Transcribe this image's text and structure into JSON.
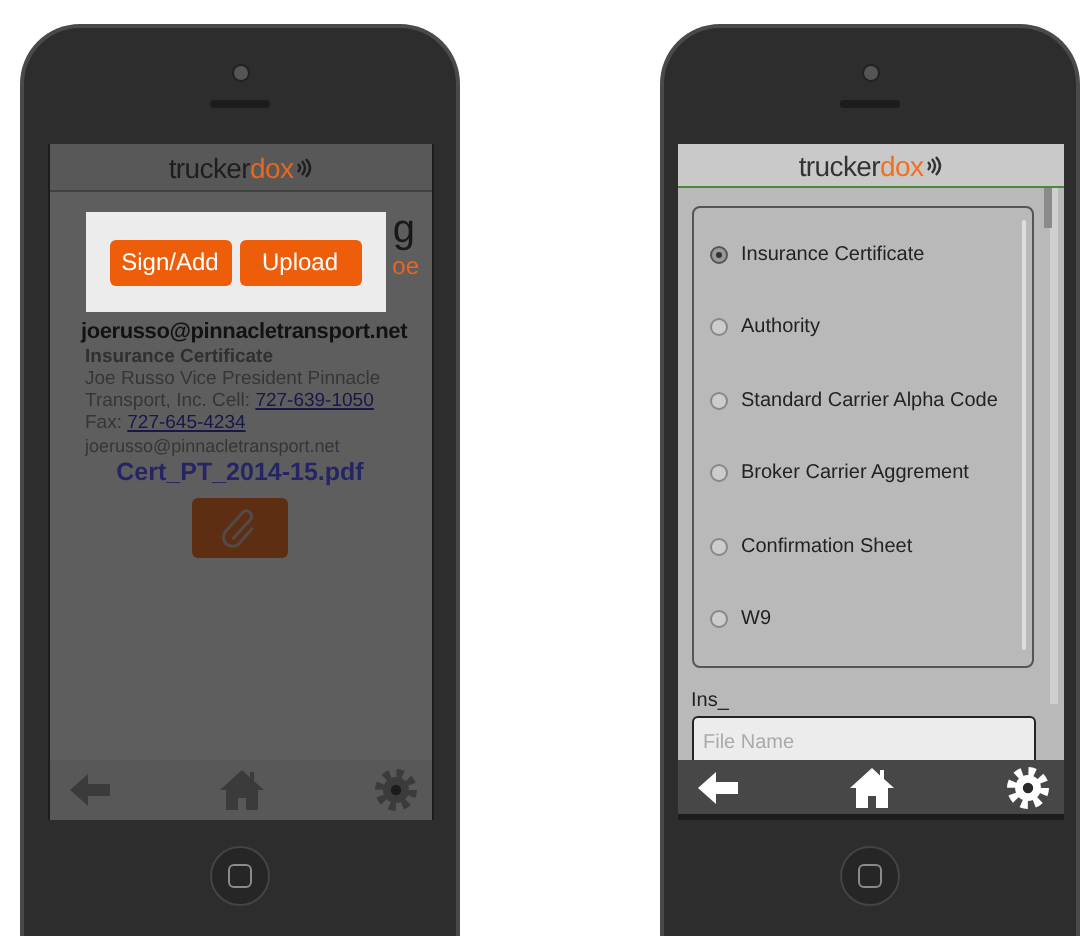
{
  "left_phone": {
    "logo": {
      "text": "trucker",
      "accent": "dox"
    },
    "dimmed": true,
    "heading_fragment": "g",
    "subheading_fragment": "oe",
    "popup": {
      "buttons": [
        "Sign/Add",
        "Upload"
      ]
    },
    "contact": {
      "email": "joerusso@pinnacletransport.net",
      "document_type": "Insurance Certificate",
      "details": [
        {
          "kind": "text",
          "text": "Joe Russo Vice President Pinnacle Transport, Inc. Cell: "
        },
        {
          "kind": "link",
          "text": "727-639-1050"
        },
        {
          "kind": "text",
          "text": " Fax: "
        },
        {
          "kind": "link",
          "text": "727-645-4234"
        }
      ],
      "email_small": "joerusso@pinnacletransport.net"
    },
    "file_link": "Cert_PT_2014-15.pdf"
  },
  "right_phone": {
    "logo": {
      "text": "trucker",
      "accent": "dox"
    },
    "documents": [
      {
        "label": "Insurance Certificate",
        "selected": true
      },
      {
        "label": "Authority",
        "selected": false
      },
      {
        "label": "Standard Carrier Alpha Code",
        "selected": false
      },
      {
        "label": "Broker Carrier Aggrement",
        "selected": false
      },
      {
        "label": "Confirmation Sheet",
        "selected": false
      },
      {
        "label": "W9",
        "selected": false
      }
    ],
    "file_label": "Ins_",
    "file_name": {
      "placeholder": "File Name"
    }
  }
}
